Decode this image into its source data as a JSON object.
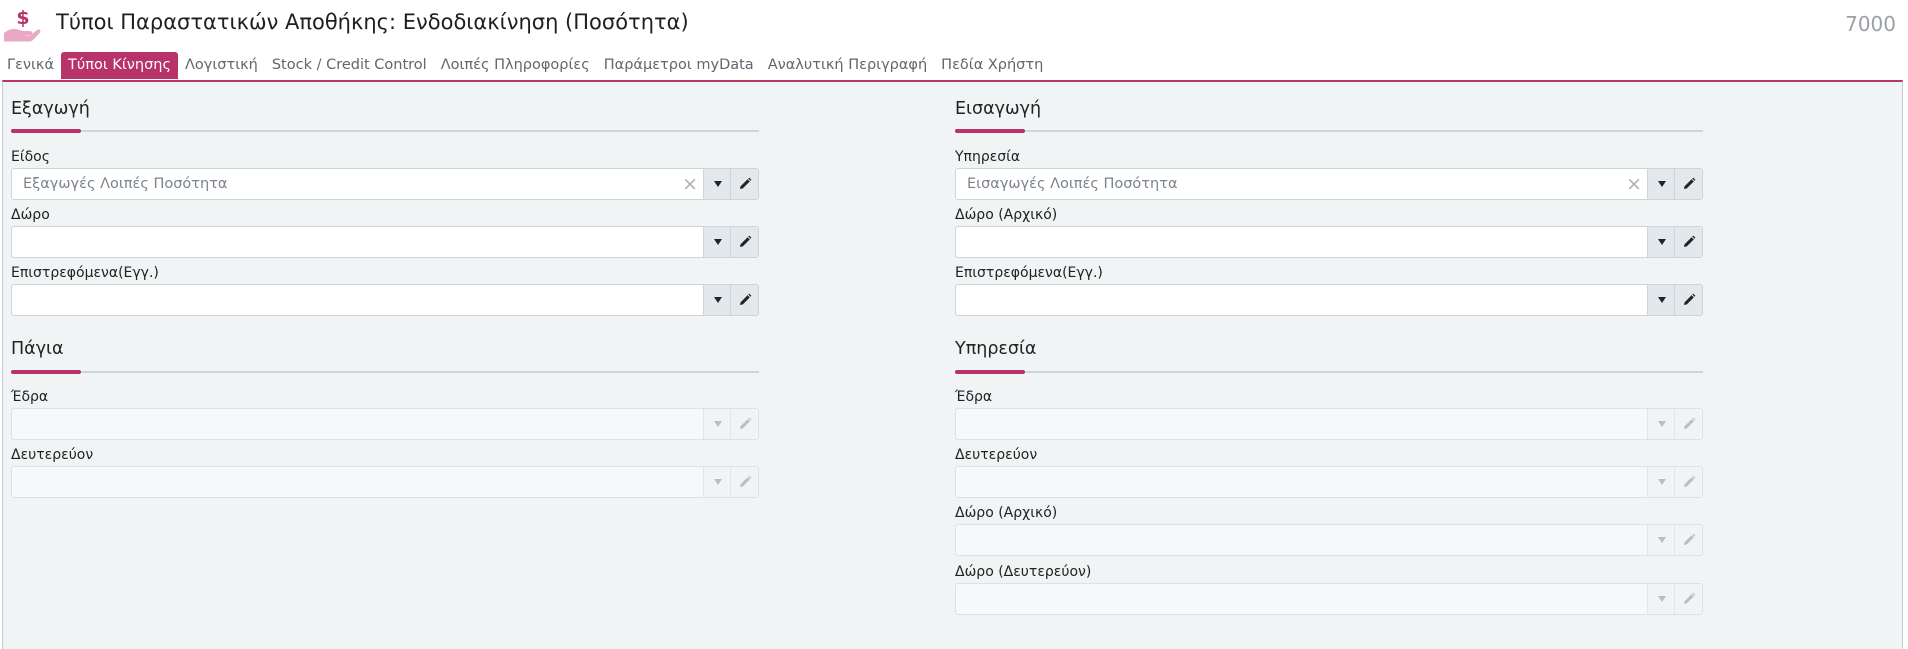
{
  "header": {
    "title": "Τύποι Παραστατικών Αποθήκης: Ενδοδιακίνηση (Ποσότητα)",
    "code": "7000",
    "logo_icon": "money-hand-icon"
  },
  "tabs": [
    {
      "label": "Γενικά",
      "active": false
    },
    {
      "label": "Τύποι Κίνησης",
      "active": true
    },
    {
      "label": "Λογιστική",
      "active": false
    },
    {
      "label": "Stock / Credit Control",
      "active": false
    },
    {
      "label": "Λοιπές Πληροφορίες",
      "active": false
    },
    {
      "label": "Παράμετροι myData",
      "active": false
    },
    {
      "label": "Αναλυτική Περιγραφή",
      "active": false
    },
    {
      "label": "Πεδία Χρήστη",
      "active": false
    }
  ],
  "left": {
    "export": {
      "title": "Εξαγωγή",
      "fields": [
        {
          "label": "Είδος",
          "value": "Εξαγωγές Λοιπές Ποσότητα"
        },
        {
          "label": "Δώρο",
          "value": ""
        },
        {
          "label": "Επιστρεφόμενα(Εγγ.)",
          "value": ""
        }
      ]
    },
    "assets": {
      "title": "Πάγια",
      "fields": [
        {
          "label": "Έδρα",
          "value": ""
        },
        {
          "label": "Δευτερεύον",
          "value": ""
        }
      ]
    }
  },
  "right": {
    "import": {
      "title": "Εισαγωγή",
      "fields": [
        {
          "label": "Υπηρεσία",
          "value": "Εισαγωγές Λοιπές Ποσότητα"
        },
        {
          "label": "Δώρο (Αρχικό)",
          "value": ""
        },
        {
          "label": "Επιστρεφόμενα(Εγγ.)",
          "value": ""
        }
      ]
    },
    "service": {
      "title": "Υπηρεσία",
      "fields": [
        {
          "label": "Έδρα",
          "value": ""
        },
        {
          "label": "Δευτερεύον",
          "value": ""
        },
        {
          "label": "Δώρο (Αρχικό)",
          "value": ""
        },
        {
          "label": "Δώρο (Δευτερεύον)",
          "value": ""
        }
      ]
    }
  },
  "colors": {
    "accent": "#b73369",
    "panel_bg": "#f1f4f5"
  }
}
